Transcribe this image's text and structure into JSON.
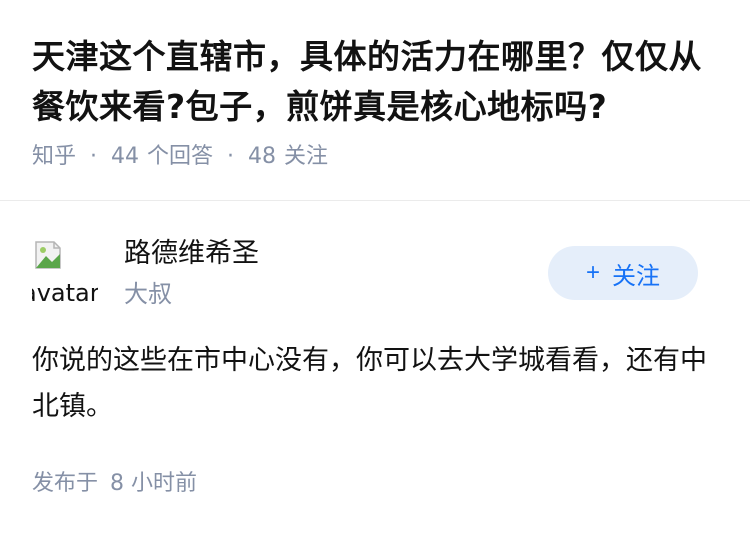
{
  "question": {
    "title": "天津这个直辖市，具体的活力在哪里？仅仅从餐饮来看?包子，煎饼真是核心地标吗?",
    "source": "知乎",
    "answer_count": "44",
    "answer_count_label": "个回答",
    "follow_count": "48",
    "follow_count_label": "关注",
    "separator": "·"
  },
  "answer": {
    "author": {
      "avatar_alt": "avatar",
      "name": "路德维希圣",
      "bio": "大叔"
    },
    "follow_button": {
      "icon": "+",
      "label": "关注"
    },
    "content": "你说的这些在市中心没有，你可以去大学城看看，还有中北镇。",
    "time_prefix": "发布于",
    "time_value": "8 小时前"
  },
  "colors": {
    "meta_gray": "#8590a6",
    "brand_blue": "#1772f6",
    "follow_bg": "#e5eefa",
    "text": "#121212"
  }
}
